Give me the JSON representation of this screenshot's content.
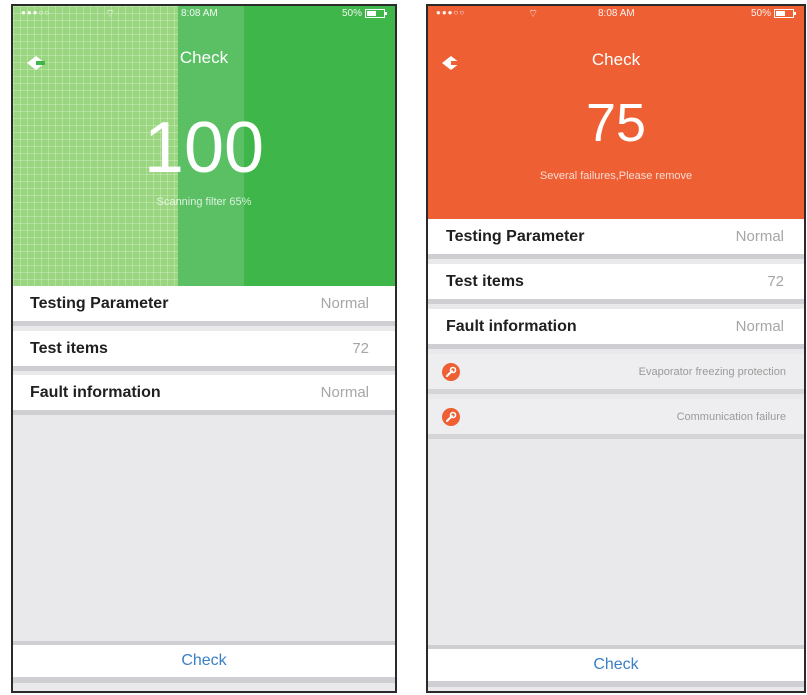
{
  "screens": [
    {
      "status": {
        "signal": "●●●○○",
        "time": "8:08 AM",
        "battery": "50%"
      },
      "title": "Check",
      "score": "100",
      "subtitle": "Scanning filter 65%",
      "progress_percent": 65,
      "header_color": "#3fb649",
      "rows": [
        {
          "label": "Testing Parameter",
          "value": "Normal"
        },
        {
          "label": "Test items",
          "value": "72"
        },
        {
          "label": "Fault information",
          "value": "Normal"
        }
      ],
      "faults": [],
      "check_button": "Check"
    },
    {
      "status": {
        "signal": "●●●○○",
        "time": "8:08 AM",
        "battery": "50%"
      },
      "title": "Check",
      "score": "75",
      "subtitle": "Several failures,Please remove",
      "header_color": "#ee5f33",
      "rows": [
        {
          "label": "Testing Parameter",
          "value": "Normal"
        },
        {
          "label": "Test items",
          "value": "72"
        },
        {
          "label": "Fault information",
          "value": "Normal"
        }
      ],
      "faults": [
        {
          "icon": "wrench-icon",
          "text": "Evaporator freezing protection"
        },
        {
          "icon": "wrench-icon",
          "text": "Communication failure"
        }
      ],
      "check_button": "Check"
    }
  ]
}
